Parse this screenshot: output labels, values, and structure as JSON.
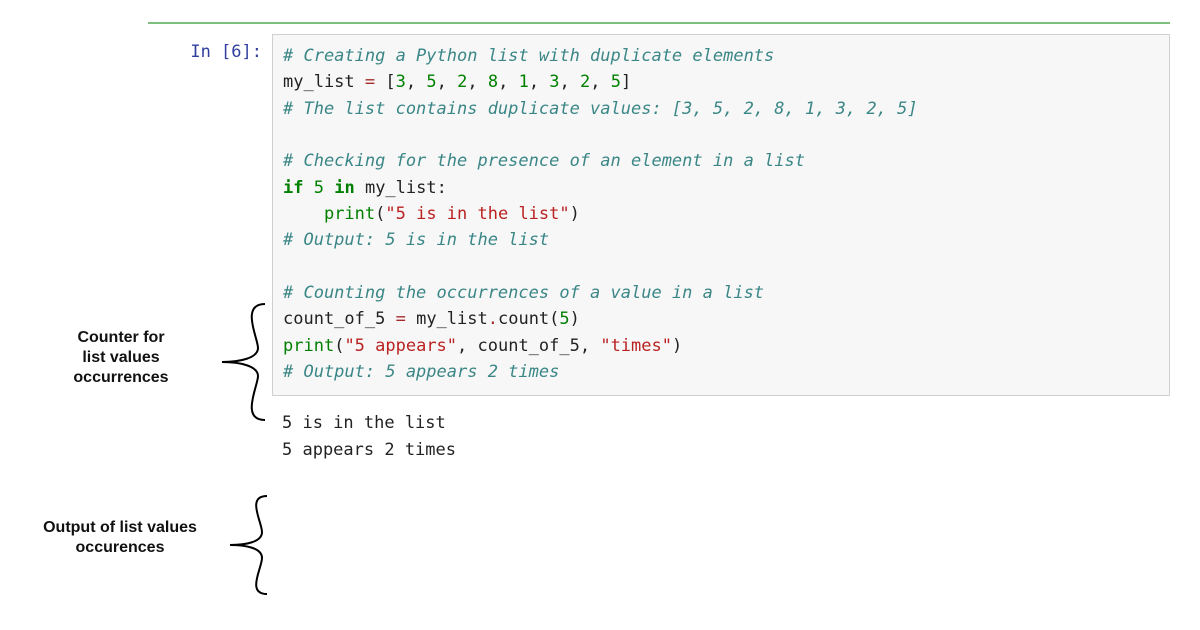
{
  "prompt": {
    "label": "In [6]:"
  },
  "code": {
    "l1_cmt": "# Creating a Python list with duplicate elements",
    "l2_a": "my_list ",
    "l2_eq": "=",
    "l2_b": " [",
    "l2_n1": "3",
    "l2_c1": ", ",
    "l2_n2": "5",
    "l2_c2": ", ",
    "l2_n3": "2",
    "l2_c3": ", ",
    "l2_n4": "8",
    "l2_c4": ", ",
    "l2_n5": "1",
    "l2_c5": ", ",
    "l2_n6": "3",
    "l2_c6": ", ",
    "l2_n7": "2",
    "l2_c7": ", ",
    "l2_n8": "5",
    "l2_close": "]",
    "l3_cmt": "# The list contains duplicate values: [3, 5, 2, 8, 1, 3, 2, 5]",
    "l5_cmt": "# Checking for the presence of an element in a list",
    "l6_if": "if",
    "l6_sp1": " ",
    "l6_5": "5",
    "l6_sp2": " ",
    "l6_in": "in",
    "l6_sp3": " my_list:",
    "l7_indent": "    ",
    "l7_print": "print",
    "l7_open": "(",
    "l7_str": "\"5 is in the list\"",
    "l7_close": ")",
    "l8_cmt": "# Output: 5 is in the list",
    "l10_cmt": "# Counting the occurrences of a value in a list",
    "l11_a": "count_of_5 ",
    "l11_eq": "=",
    "l11_b": " my_list",
    "l11_dot": ".",
    "l11_count": "count(",
    "l11_num": "5",
    "l11_close": ")",
    "l12_print": "print",
    "l12_open": "(",
    "l12_s1": "\"5 appears\"",
    "l12_c1": ", count_of_5, ",
    "l12_s2": "\"times\"",
    "l12_close": ")",
    "l13_cmt": "# Output: 5 appears 2 times"
  },
  "output": {
    "l1": "5 is in the list",
    "l2": "5 appears 2 times"
  },
  "annotations": {
    "counter_label_l1": "Counter for",
    "counter_label_l2": "list values",
    "counter_label_l3": "occurrences",
    "output_label_l1": "Output of list values",
    "output_label_l2": "occurences"
  }
}
